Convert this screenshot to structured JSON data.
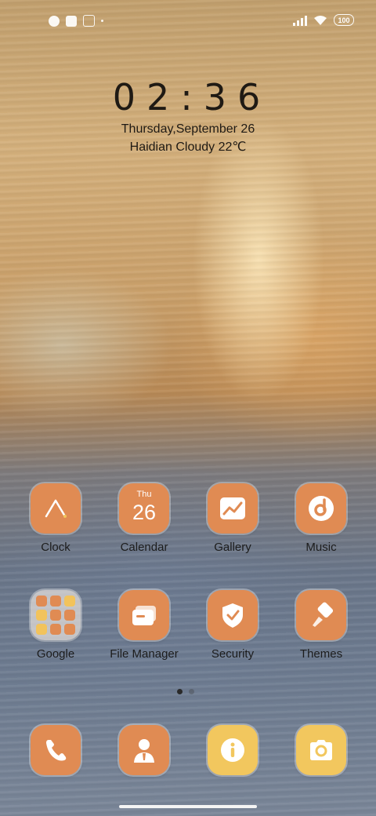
{
  "status_bar": {
    "battery": "100",
    "icons": [
      "notification-icon",
      "notification-icon",
      "box-icon",
      "dot-icon",
      "signal-icon",
      "wifi-icon",
      "battery-icon"
    ]
  },
  "clock_widget": {
    "time": "02:36",
    "date": "Thursday,September 26",
    "weather": "Haidian Cloudy 22℃"
  },
  "apps": [
    {
      "label": "Clock",
      "icon": "clock-icon"
    },
    {
      "label": "Calendar",
      "icon": "calendar-icon",
      "month": "Thu",
      "day": "26"
    },
    {
      "label": "Gallery",
      "icon": "gallery-icon"
    },
    {
      "label": "Music",
      "icon": "music-icon"
    },
    {
      "label": "Google",
      "icon": "folder-icon"
    },
    {
      "label": "File Manager",
      "icon": "file-manager-icon"
    },
    {
      "label": "Security",
      "icon": "security-icon"
    },
    {
      "label": "Themes",
      "icon": "themes-icon"
    }
  ],
  "dock": [
    {
      "icon": "phone-icon"
    },
    {
      "icon": "contacts-icon"
    },
    {
      "icon": "info-icon"
    },
    {
      "icon": "camera-icon"
    }
  ],
  "page_indicator": {
    "pages": 2,
    "current": 1
  },
  "colors": {
    "accent": "#e08b53",
    "accent_yellow": "#f2c75e"
  }
}
